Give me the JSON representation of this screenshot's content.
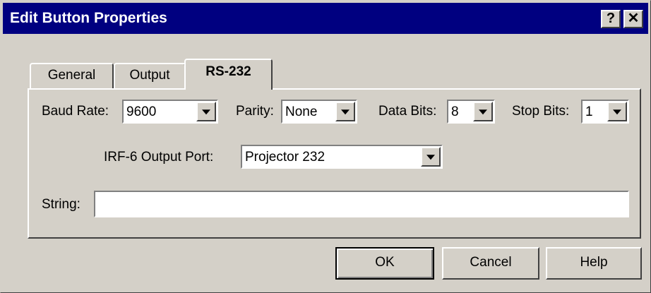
{
  "window": {
    "title": "Edit Button Properties",
    "help_button": "?",
    "close_button": "✕"
  },
  "tabs": [
    {
      "label": "General"
    },
    {
      "label": "Output"
    },
    {
      "label": "RS-232",
      "active": true
    }
  ],
  "rs232": {
    "baud_rate_label": "Baud Rate:",
    "baud_rate_value": "9600",
    "parity_label": "Parity:",
    "parity_value": "None",
    "data_bits_label": "Data Bits:",
    "data_bits_value": "8",
    "stop_bits_label": "Stop Bits:",
    "stop_bits_value": "1",
    "output_port_label": "IRF-6 Output Port:",
    "output_port_value": "Projector 232",
    "string_label": "String:",
    "string_value": ""
  },
  "buttons": {
    "ok": "OK",
    "cancel": "Cancel",
    "help": "Help"
  }
}
